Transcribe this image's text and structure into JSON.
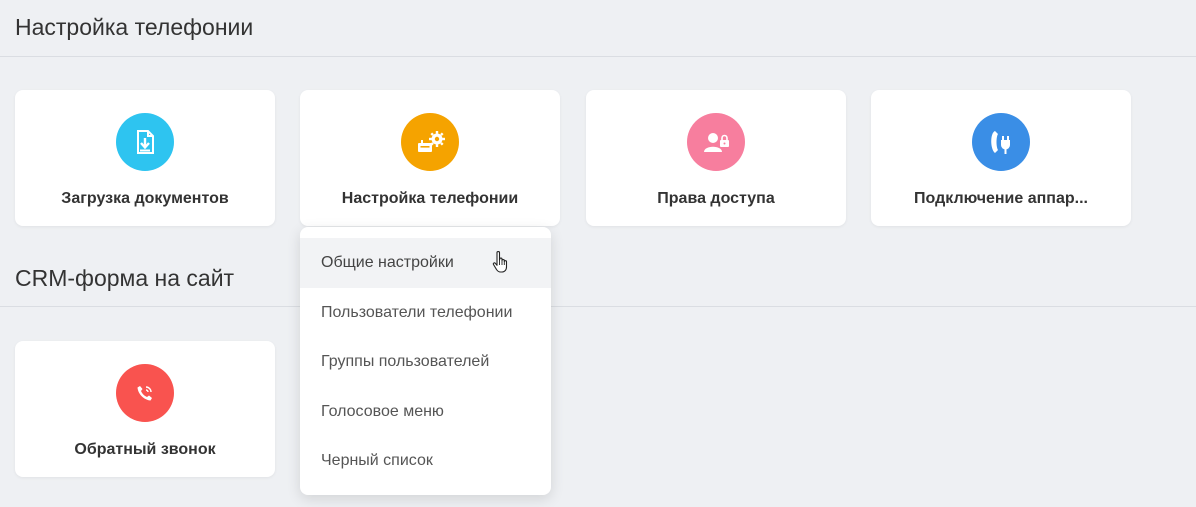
{
  "sections": [
    {
      "title": "Настройка телефонии",
      "tiles": [
        {
          "label": "Загрузка документов",
          "icon": "document-download-icon",
          "color": "#2ec4f0"
        },
        {
          "label": "Настройка телефонии",
          "icon": "phone-settings-icon",
          "color": "#f5a300"
        },
        {
          "label": "Права доступа",
          "icon": "user-lock-icon",
          "color": "#f77e9e"
        },
        {
          "label": "Подключение аппар...",
          "icon": "phone-plug-icon",
          "color": "#3a8ee6"
        }
      ]
    },
    {
      "title": "CRM-форма на сайт",
      "tiles": [
        {
          "label": "Обратный звонок",
          "icon": "callback-phone-icon",
          "color": "#f9534f"
        }
      ]
    }
  ],
  "dropdown": {
    "items": [
      {
        "label": "Общие настройки",
        "hovered": true
      },
      {
        "label": "Пользователи телефонии"
      },
      {
        "label": "Группы пользователей"
      },
      {
        "label": "Голосовое меню"
      },
      {
        "label": "Черный список"
      }
    ]
  }
}
